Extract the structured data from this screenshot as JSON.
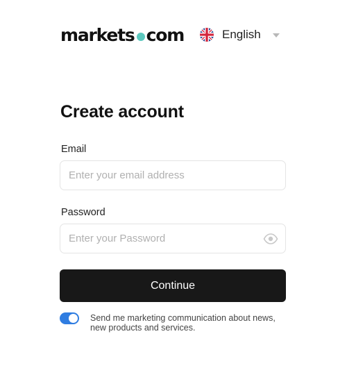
{
  "header": {
    "logo_left": "markets",
    "logo_right": "com",
    "language": {
      "label": "English",
      "flag_icon": "uk-flag-icon",
      "chevron_icon": "chevron-down-icon"
    }
  },
  "form": {
    "title": "Create account",
    "email": {
      "label": "Email",
      "value": "",
      "placeholder": "Enter your email address"
    },
    "password": {
      "label": "Password",
      "value": "",
      "placeholder": "Enter your Password",
      "visibility_icon": "eye-icon"
    },
    "continue_label": "Continue",
    "marketing": {
      "enabled": true,
      "text": "Send me marketing communication about news, new products and services."
    }
  },
  "colors": {
    "brand_dot": "#5cc8be",
    "button": "#181818",
    "toggle_on": "#2f7de1",
    "field_border": "#e4e4e4"
  }
}
